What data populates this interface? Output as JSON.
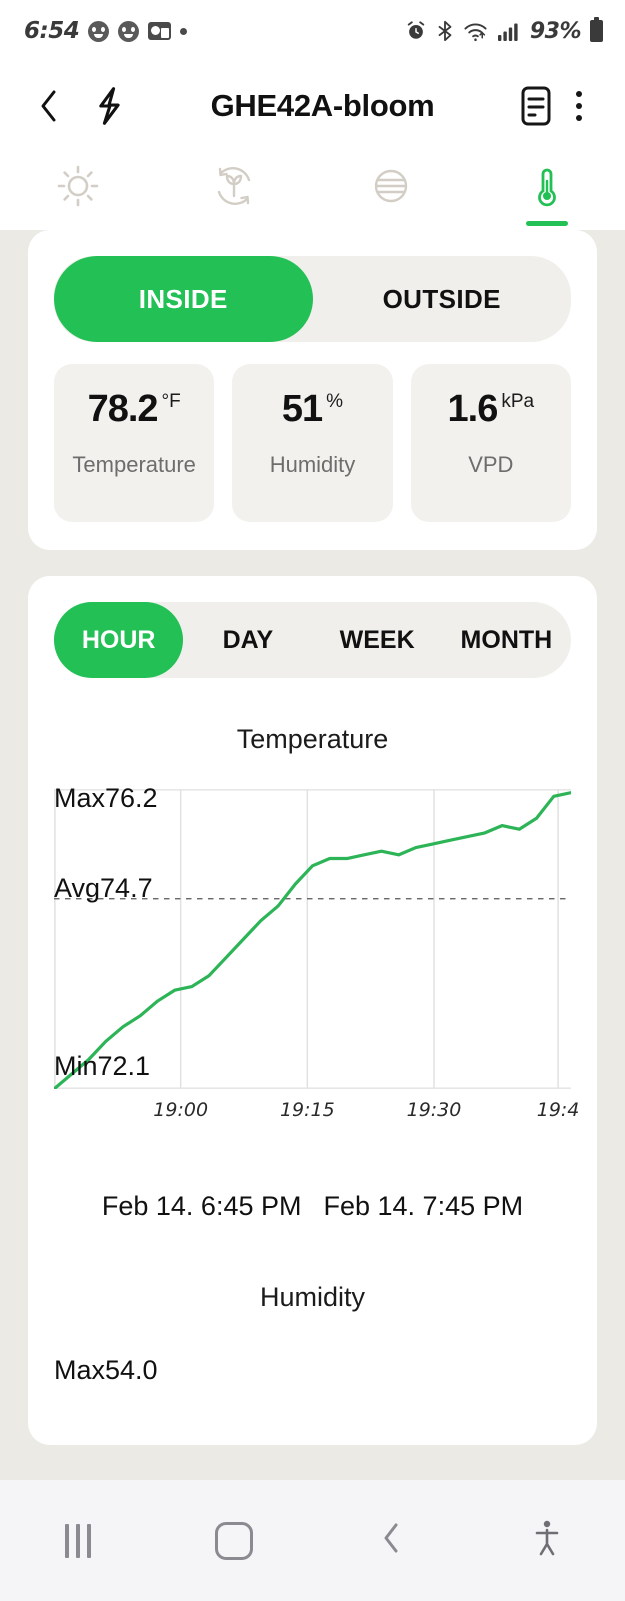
{
  "statusbar": {
    "time": "6:54",
    "battery": "93%",
    "icons": [
      "avatar-badge-icon",
      "avatar-badge-icon",
      "card-badge-icon",
      "dot-icon",
      "alarm-icon",
      "bluetooth-icon",
      "wifi-icon",
      "cellular-icon"
    ]
  },
  "appbar": {
    "back_icon": "chevron-left-icon",
    "bolt_icon": "lightning-bolt-icon",
    "title": "GHE42A-bloom",
    "notes_icon": "document-notes-icon",
    "menu_icon": "kebab-menu-icon"
  },
  "tabs": [
    {
      "name": "light",
      "icon": "sun-icon",
      "active": false
    },
    {
      "name": "cycle",
      "icon": "plant-cycle-icon",
      "active": false
    },
    {
      "name": "ventilation",
      "icon": "fan-lines-icon",
      "active": false
    },
    {
      "name": "climate",
      "icon": "thermometer-icon",
      "active": true
    }
  ],
  "location_toggle": {
    "options": [
      "INSIDE",
      "OUTSIDE"
    ],
    "selected": "INSIDE"
  },
  "stats": [
    {
      "value": "78.2",
      "unit": "°F",
      "label": "Temperature"
    },
    {
      "value": "51",
      "unit": "%",
      "label": "Humidity"
    },
    {
      "value": "1.6",
      "unit": "kPa",
      "label": "VPD"
    }
  ],
  "range_selector": {
    "options": [
      "HOUR",
      "DAY",
      "WEEK",
      "MONTH"
    ],
    "selected": "HOUR"
  },
  "date_range": {
    "start": "Feb 14. 6:45 PM",
    "end": "Feb 14. 7:45 PM"
  },
  "humidity_section": {
    "title": "Humidity",
    "max_label": "Max54.0"
  },
  "colors": {
    "accent_green": "#22c055",
    "line_green": "#2cb457",
    "page_bg": "#eceae5",
    "card_bg": "#ffffff",
    "tile_bg": "#f2f1ee",
    "muted_text": "#6d6d6d"
  },
  "chart_data": {
    "type": "line",
    "title": "Temperature",
    "xlabel": "",
    "ylabel": "",
    "grid": true,
    "legend": "none",
    "max_label": "Max76.2",
    "avg_label": "Avg74.7",
    "min_label": "Min72.1",
    "max": 76.2,
    "avg": 74.7,
    "min": 72.1,
    "ylim": [
      72.1,
      76.2
    ],
    "xtick_labels": [
      "19:00",
      "19:15",
      "19:30",
      "19:4"
    ],
    "xtick_positions": [
      0.245,
      0.49,
      0.735,
      0.975
    ],
    "avg_line": {
      "value": 74.7,
      "style": "dashed"
    },
    "x": [
      "18:45",
      "18:47",
      "18:49",
      "18:51",
      "18:53",
      "18:55",
      "18:57",
      "18:59",
      "19:01",
      "19:03",
      "19:05",
      "19:07",
      "19:09",
      "19:11",
      "19:13",
      "19:15",
      "19:17",
      "19:19",
      "19:21",
      "19:23",
      "19:25",
      "19:27",
      "19:29",
      "19:31",
      "19:33",
      "19:35",
      "19:37",
      "19:39",
      "19:41",
      "19:43",
      "19:45"
    ],
    "values": [
      72.1,
      72.3,
      72.5,
      72.75,
      72.95,
      73.1,
      73.3,
      73.45,
      73.5,
      73.65,
      73.9,
      74.15,
      74.4,
      74.6,
      74.9,
      75.15,
      75.25,
      75.25,
      75.3,
      75.35,
      75.3,
      75.4,
      75.45,
      75.5,
      75.55,
      75.6,
      75.7,
      75.65,
      75.8,
      76.1,
      76.15
    ],
    "series_color": "#2cb457"
  },
  "navbar": {
    "recents_icon": "recents-icon",
    "home_icon": "home-icon",
    "back_icon": "nav-back-icon",
    "accessibility_icon": "accessibility-icon"
  }
}
